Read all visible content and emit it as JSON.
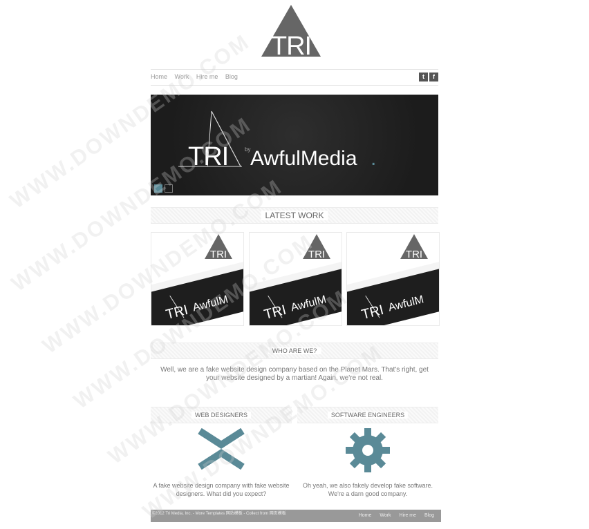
{
  "logo": {
    "text": "TRI"
  },
  "nav": {
    "items": [
      "Home",
      "Work",
      "Hire me",
      "Blog"
    ]
  },
  "social": {
    "twitter": "t",
    "facebook": "f"
  },
  "hero": {
    "logo_text": "TRI",
    "by": "by",
    "brand": "AwfulMedia",
    "dot": ".",
    "slide_count": 2,
    "active_slide": 1
  },
  "latest_work": {
    "title": "LATEST WORK",
    "thumb_logo": "TRI",
    "thumb_brand": "AwfulM"
  },
  "who": {
    "title": "WHO ARE WE?",
    "text": "Well, we are a fake website design company based on the Planet Mars. That's right, get your website designed by a martian! Again, we're not real."
  },
  "features": [
    {
      "title": "WEB DESIGNERS",
      "text": "A fake website design company with fake website designers. What did you expect?",
      "icon": "chevron-icon"
    },
    {
      "title": "SOFTWARE ENGINEERS",
      "text": "Oh yeah, we also fakely develop fake software. We're a darn good company.",
      "icon": "gear-icon"
    }
  ],
  "footer": {
    "copyright": "©2012 Tri Media, Inc. - More Templates 网站模板 - Collect from 网页模板",
    "nav": [
      "Home",
      "Work",
      "Hire me",
      "Blog"
    ]
  },
  "watermark": "WWW.DOWNDEMO.COM",
  "colors": {
    "accent": "#5a8a97",
    "dark": "#222222",
    "gray": "#555555"
  }
}
